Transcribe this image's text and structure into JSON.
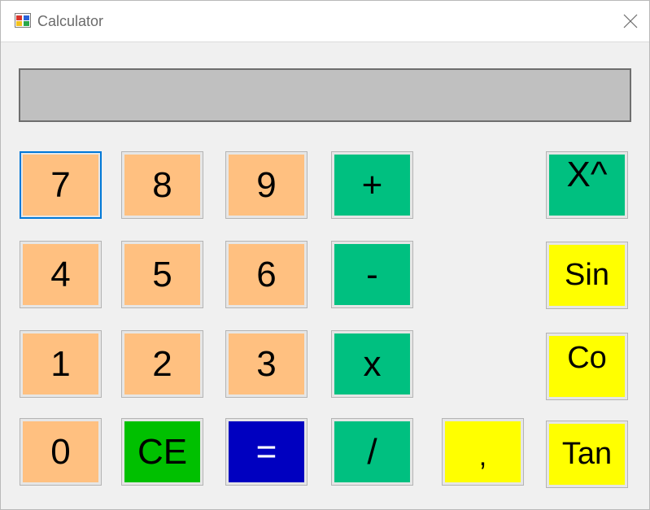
{
  "window": {
    "title": "Calculator"
  },
  "display": {
    "value": ""
  },
  "colors": {
    "digit": "#ffc080",
    "operator": "#00c080",
    "clear": "#00c000",
    "equals": "#0000c0",
    "function": "#ffff00",
    "display_bg": "#c0c0c0"
  },
  "keys": {
    "k7": "7",
    "k8": "8",
    "k9": "9",
    "plus": "+",
    "pow": "X^",
    "k4": "4",
    "k5": "5",
    "k6": "6",
    "minus": "-",
    "sin": "Sin",
    "k1": "1",
    "k2": "2",
    "k3": "3",
    "mul": "x",
    "cos": "Co",
    "k0": "0",
    "ce": "CE",
    "eq": "=",
    "div": "/",
    "comma": ",",
    "tan": "Tan"
  }
}
